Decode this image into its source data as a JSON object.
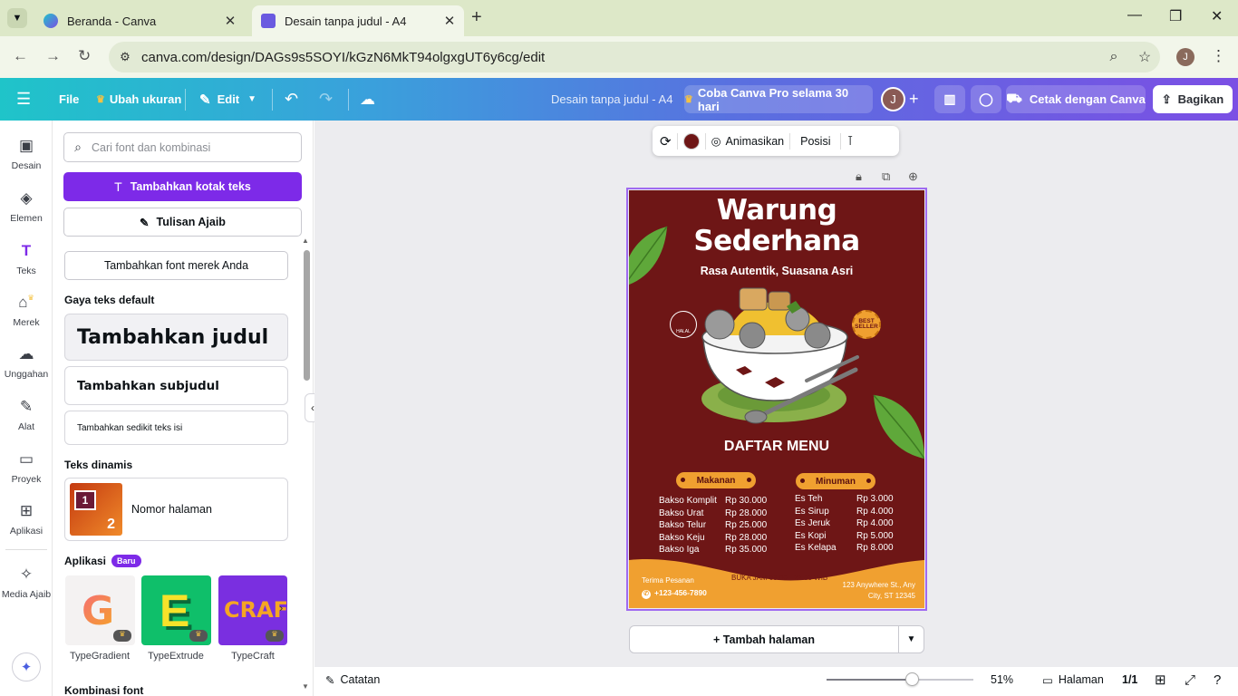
{
  "browser": {
    "tabs": [
      {
        "title": "Beranda - Canva",
        "active": false
      },
      {
        "title": "Desain tanpa judul - A4",
        "active": true
      }
    ],
    "url": "canva.com/design/DAGs9s5SOYI/kGzN6MkT94olgxgUT6y6cg/edit",
    "profile_initial": "J"
  },
  "topbar": {
    "file": "File",
    "resize": "Ubah ukuran",
    "edit": "Edit",
    "doc_title": "Desain tanpa judul - A4",
    "pro_trial": "Coba Canva Pro selama 30 hari",
    "user_initial": "J",
    "print": "Cetak dengan Canva",
    "share": "Bagikan"
  },
  "rail": {
    "items": [
      {
        "label": "Desain",
        "icon": "design-icon"
      },
      {
        "label": "Elemen",
        "icon": "elements-icon"
      },
      {
        "label": "Teks",
        "icon": "text-icon"
      },
      {
        "label": "Merek",
        "icon": "brand-icon"
      },
      {
        "label": "Unggahan",
        "icon": "upload-icon"
      },
      {
        "label": "Alat",
        "icon": "draw-icon"
      },
      {
        "label": "Proyek",
        "icon": "folder-icon"
      },
      {
        "label": "Aplikasi",
        "icon": "apps-icon"
      },
      {
        "label": "Media Ajaib",
        "icon": "magic-media-icon"
      }
    ]
  },
  "panel": {
    "search_placeholder": "Cari font dan kombinasi",
    "add_textbox": "Tambahkan kotak teks",
    "magic_write": "Tulisan Ajaib",
    "add_brand_font": "Tambahkan font merek Anda",
    "default_styles_heading": "Gaya teks default",
    "heading": "Tambahkan judul",
    "subheading": "Tambahkan subjudul",
    "body": "Tambahkan sedikit teks isi",
    "dynamic_heading": "Teks dinamis",
    "page_number": "Nomor halaman",
    "apps_heading": "Aplikasi",
    "apps_badge": "Baru",
    "apps": [
      {
        "name": "TypeGradient"
      },
      {
        "name": "TypeExtrude"
      },
      {
        "name": "TypeCraft"
      }
    ],
    "font_combos_heading": "Kombinasi font"
  },
  "context_toolbar": {
    "color": "#6e1616",
    "animate": "Animasikan",
    "position": "Posisi"
  },
  "poster": {
    "title_line1": "Warung",
    "title_line2": "Sederhana",
    "subtitle": "Rasa Autentik, Suasana Asri",
    "halal": "HALAL",
    "best_seller": "BEST SELLER",
    "menu_heading": "DAFTAR MENU",
    "food_heading": "Makanan",
    "drink_heading": "Minuman",
    "food": [
      {
        "name": "Bakso Komplit",
        "price": "Rp 30.000"
      },
      {
        "name": "Bakso Urat",
        "price": "Rp 28.000"
      },
      {
        "name": "Bakso Telur",
        "price": "Rp 25.000"
      },
      {
        "name": "Bakso Keju",
        "price": "Rp 28.000"
      },
      {
        "name": "Bakso Iga",
        "price": "Rp 35.000"
      }
    ],
    "drinks": [
      {
        "name": "Es Teh",
        "price": "Rp 3.000"
      },
      {
        "name": "Es Sirup",
        "price": "Rp 4.000"
      },
      {
        "name": "Es Jeruk",
        "price": "Rp 4.000"
      },
      {
        "name": "Es Kopi",
        "price": "Rp 5.000"
      },
      {
        "name": "Es Kelapa",
        "price": "Rp 8.000"
      }
    ],
    "order_label": "Terima Pesanan",
    "phone": "+123-456-7890",
    "hours": "BUKA JAM 09:00 - 22:00 WIB",
    "address_line1": "123 Anywhere St., Any",
    "address_line2": "City, ST 12345",
    "bg_color": "#6e1616",
    "accent_color": "#f0a030"
  },
  "canvas": {
    "add_page": "+ Tambah halaman"
  },
  "bottombar": {
    "notes": "Catatan",
    "zoom": "51%",
    "zoom_fraction": 0.51,
    "pages_label": "Halaman",
    "page_count": "1/1"
  }
}
